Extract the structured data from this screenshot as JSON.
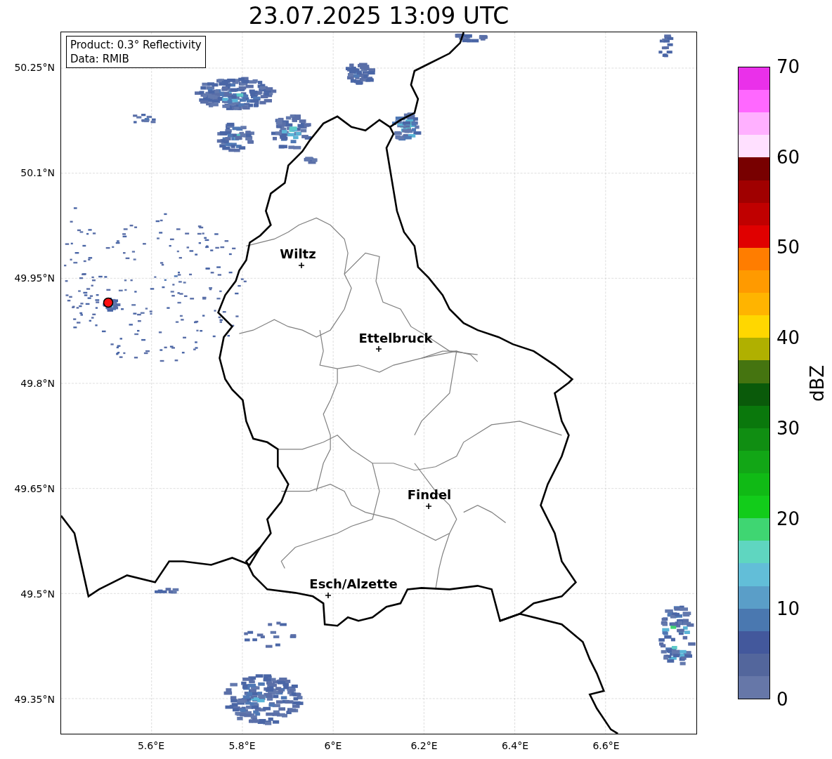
{
  "title": "23.07.2025 13:09 UTC",
  "map": {
    "info_box": [
      "Product: 0.3° Reflectivity",
      "Data: RMIB"
    ],
    "lat_ticks": [
      "50.25°N",
      "50.1°N",
      "49.95°N",
      "49.8°N",
      "49.65°N",
      "49.5°N",
      "49.35°N"
    ],
    "lon_ticks": [
      "5.6°E",
      "5.8°E",
      "6°E",
      "6.2°E",
      "6.4°E",
      "6.6°E"
    ],
    "cities": [
      {
        "name": "Wiltz"
      },
      {
        "name": "Ettelbruck"
      },
      {
        "name": "Findel"
      },
      {
        "name": "Esch/Alzette"
      }
    ]
  },
  "colorbar": {
    "label": "dBZ",
    "ticks": [
      "70",
      "60",
      "50",
      "40",
      "30",
      "20",
      "10",
      "0"
    ],
    "bins": [
      {
        "color": "#ea30ea"
      },
      {
        "color": "#ff68ff"
      },
      {
        "color": "#ffb0ff"
      },
      {
        "color": "#ffe0ff"
      },
      {
        "color": "#780000"
      },
      {
        "color": "#a00000"
      },
      {
        "color": "#c00000"
      },
      {
        "color": "#e00000"
      },
      {
        "color": "#ff7d00"
      },
      {
        "color": "#ff9a00"
      },
      {
        "color": "#ffb400"
      },
      {
        "color": "#ffd700"
      },
      {
        "color": "#b0b000"
      },
      {
        "color": "#457410"
      },
      {
        "color": "#0a5a0a"
      },
      {
        "color": "#0a780c"
      },
      {
        "color": "#108e12"
      },
      {
        "color": "#12a616"
      },
      {
        "color": "#10ba15"
      },
      {
        "color": "#12cc1a"
      },
      {
        "color": "#3fd672"
      },
      {
        "color": "#5fd6c0"
      },
      {
        "color": "#62bed8"
      },
      {
        "color": "#5a9ec8"
      },
      {
        "color": "#4a78b0"
      },
      {
        "color": "#43589c"
      },
      {
        "color": "#53669c"
      },
      {
        "color": "#6677a8"
      }
    ]
  }
}
